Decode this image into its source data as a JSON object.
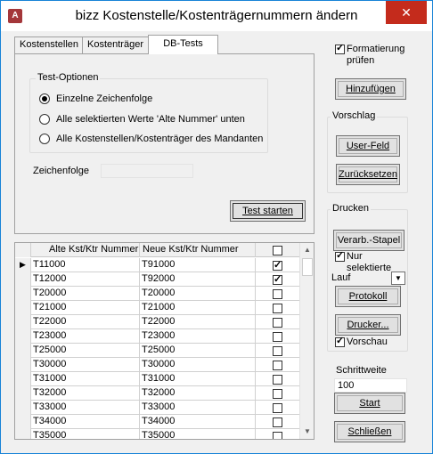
{
  "window": {
    "title": "bizz Kostenstelle/Kostenträgernummern ändern",
    "app_icon_text": "A",
    "close_glyph": "✕"
  },
  "tabs": [
    {
      "label": "Kostenstellen",
      "active": false
    },
    {
      "label": "Kostenträger",
      "active": false
    },
    {
      "label": "DB-Tests",
      "active": true
    }
  ],
  "test_options": {
    "legend": "Test-Optionen",
    "options": [
      {
        "label": "Einzelne Zeichenfolge",
        "selected": true
      },
      {
        "label": "Alle selektierten Werte 'Alte Nummer' unten",
        "selected": false
      },
      {
        "label": "Alle Kostenstellen/Kostenträger des Mandanten",
        "selected": false
      }
    ]
  },
  "zeichenfolge": {
    "label": "Zeichenfolge",
    "value": ""
  },
  "test_button": "Test starten",
  "right_panel": {
    "formatierung": {
      "label_line1": "Formatierung",
      "label_line2": "prüfen",
      "checked": true
    },
    "hinzufuegen": "Hinzufügen",
    "vorschlag": {
      "legend": "Vorschlag",
      "user_feld": "User-Feld",
      "zuruecksetzen": "Zurücksetzen"
    },
    "drucken": {
      "legend": "Drucken",
      "verarb_stapel": "Verarb.-Stapel",
      "nur_selektierte": {
        "label": "Nur selektierte",
        "checked": true
      },
      "lauf": "Lauf",
      "protokoll": "Protokoll",
      "drucker": "Drucker...",
      "vorschau": {
        "label": "Vorschau",
        "checked": true
      }
    },
    "schrittweite": {
      "label": "Schrittweite",
      "value": "100"
    },
    "start": "Start",
    "schliessen": "Schließen"
  },
  "grid": {
    "headers": {
      "old": "Alte Kst/Ktr Nummer",
      "new": "Neue Kst/Ktr Nummer"
    },
    "header_checked": false,
    "pointer_glyph": "▶",
    "rows": [
      {
        "old": "T11000",
        "new": "T91000",
        "checked": true,
        "current": true
      },
      {
        "old": "T12000",
        "new": "T92000",
        "checked": true,
        "current": false
      },
      {
        "old": "T20000",
        "new": "T20000",
        "checked": false,
        "current": false
      },
      {
        "old": "T21000",
        "new": "T21000",
        "checked": false,
        "current": false
      },
      {
        "old": "T22000",
        "new": "T22000",
        "checked": false,
        "current": false
      },
      {
        "old": "T23000",
        "new": "T23000",
        "checked": false,
        "current": false
      },
      {
        "old": "T25000",
        "new": "T25000",
        "checked": false,
        "current": false
      },
      {
        "old": "T30000",
        "new": "T30000",
        "checked": false,
        "current": false
      },
      {
        "old": "T31000",
        "new": "T31000",
        "checked": false,
        "current": false
      },
      {
        "old": "T32000",
        "new": "T32000",
        "checked": false,
        "current": false
      },
      {
        "old": "T33000",
        "new": "T33000",
        "checked": false,
        "current": false
      },
      {
        "old": "T34000",
        "new": "T34000",
        "checked": false,
        "current": false
      },
      {
        "old": "T35000",
        "new": "T35000",
        "checked": false,
        "current": false
      }
    ]
  }
}
